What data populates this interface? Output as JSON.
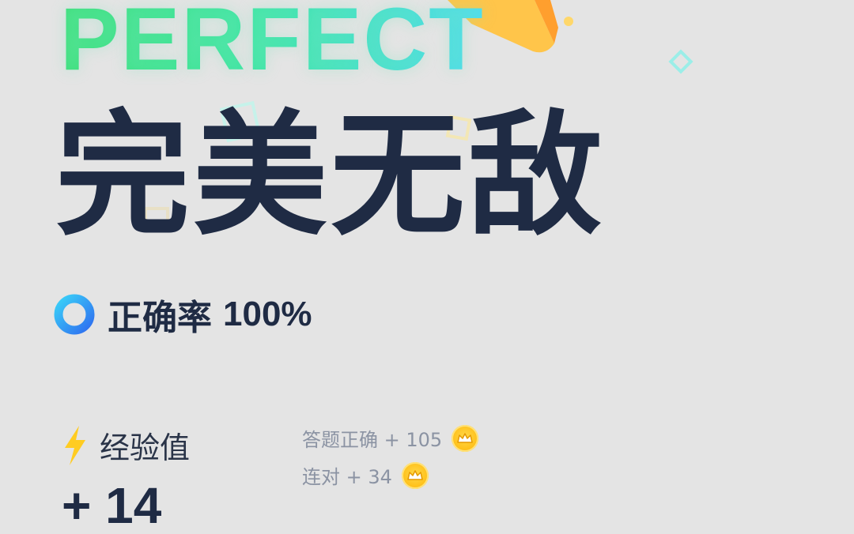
{
  "banner": {
    "text": "PERFECT"
  },
  "result": {
    "title": "完美无敌"
  },
  "accuracy": {
    "label": "正确率",
    "value": "100%",
    "icon": "ring-progress-icon"
  },
  "experience": {
    "label": "经验值",
    "value": "+ 14",
    "icon": "lightning-icon",
    "bonuses": [
      {
        "label": "答题正确 + 105",
        "icon": "crown-coin-icon"
      },
      {
        "label": "连对 + 34",
        "icon": "crown-coin-icon"
      }
    ]
  },
  "colors": {
    "background": "#e4e4e4",
    "title": "#1f2b44",
    "accent_blue": "#3a8ef6",
    "coin": "#ffc21d",
    "muted": "#8b93a3"
  }
}
